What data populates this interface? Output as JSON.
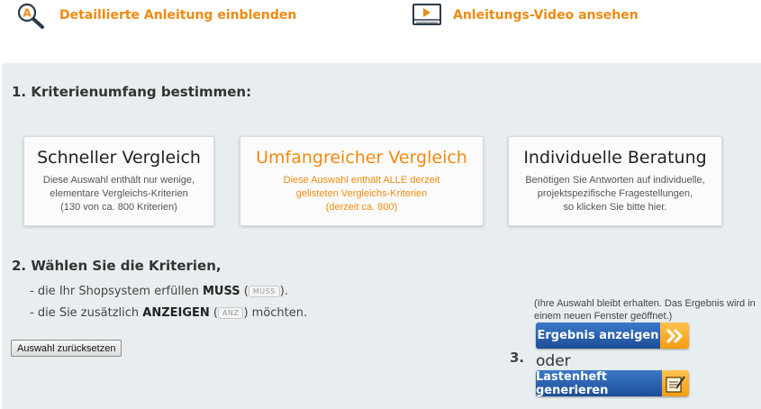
{
  "header": {
    "guide_link": "Detaillierte Anleitung einblenden",
    "video_link": "Anleitungs-Video ansehen"
  },
  "step1": {
    "heading": "1. Kriterienumfang bestimmen:",
    "cards": [
      {
        "title": "Schneller Vergleich",
        "desc": "Diese Auswahl enthält nur wenige,\nelementare Vergleichs-Kriterien\n(130 von ca. 800 Kriterien)",
        "active": false
      },
      {
        "title": "Umfangreicher Vergleich",
        "desc": "Diese Auswahl enthält ALLE derzeit\ngelisteten Vergleichs-Kriterien\n(derzeit ca. 800)",
        "active": true
      },
      {
        "title": "Individuelle Beratung",
        "desc": "Benötigen Sie Antworten auf individuelle,\nprojektspezifische Fragestellungen,\nso klicken Sie bitte hier.",
        "active": false
      }
    ]
  },
  "step2": {
    "heading": "2. Wählen Sie die Kriterien,",
    "line1": {
      "prefix": "- die Ihr Shopsystem erfüllen ",
      "keyword": "MUSS",
      "tag": "MUSS",
      "suffix": "."
    },
    "line2": {
      "prefix": "- die Sie zusätzlich ",
      "keyword": "ANZEIGEN",
      "tag": "ANZ",
      "suffix": " möchten."
    },
    "reset_label": "Auswahl zurücksetzen"
  },
  "step3": {
    "number": "3.",
    "note": "(Ihre Auswahl bleibt erhalten. Das Ergebnis wird in einem neuen Fenster geöffnet.)",
    "result_label": "Ergebnis anzeigen",
    "or_label": "oder",
    "spec_label": "Lastenheft generieren"
  },
  "colors": {
    "accent": "#f08a10",
    "button_blue": "#1d4e96",
    "panel_bg": "#e8eef0"
  },
  "icons": {
    "guide": "magnifier-a-icon",
    "video": "video-player-icon",
    "result": "double-chevron-icon",
    "spec": "document-pen-icon"
  }
}
